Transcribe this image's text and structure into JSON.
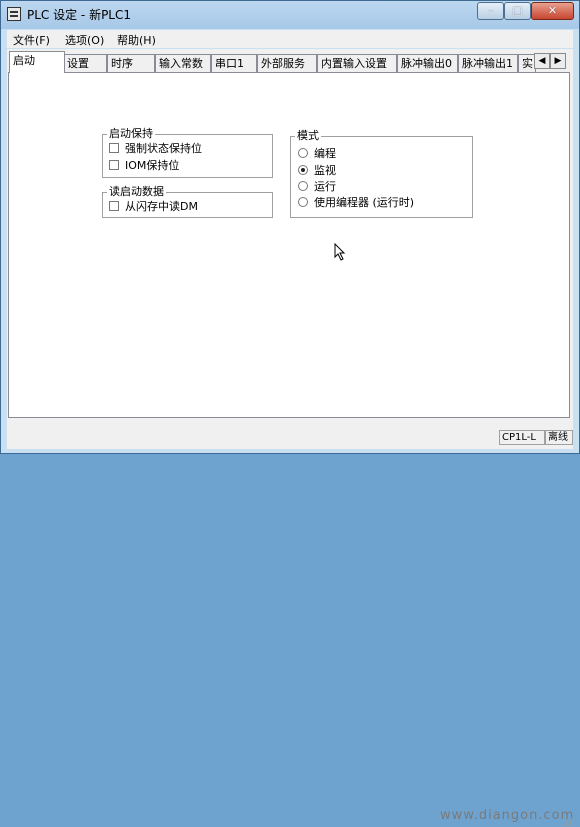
{
  "window": {
    "title": "PLC 设定 - 新PLC1"
  },
  "menu": [
    "文件(F)",
    "选项(O)",
    "帮助(H)"
  ],
  "tabs": [
    "启动",
    "设置",
    "时序",
    "输入常数",
    "串口1",
    "外部服务",
    "内置输入设置",
    "脉冲输出0",
    "脉冲输出1",
    "实"
  ],
  "startup_hold": {
    "title": "启动保持",
    "options": [
      {
        "label": "强制状态保持位",
        "checked": false
      },
      {
        "label": "IOM保持位",
        "checked": false
      }
    ]
  },
  "startup_read": {
    "title": "读启动数据",
    "options": [
      {
        "label": "从闪存中读DM",
        "checked": false
      }
    ]
  },
  "mode": {
    "title": "模式",
    "options": [
      {
        "label": "编程",
        "selected": false
      },
      {
        "label": "监视",
        "selected": true
      },
      {
        "label": "运行",
        "selected": false
      },
      {
        "label": "使用编程器 (运行时)",
        "selected": false
      }
    ]
  },
  "statusbar": {
    "plc_model": "CP1L-L",
    "connection": "离线"
  },
  "watermark": "www.diangon.com"
}
